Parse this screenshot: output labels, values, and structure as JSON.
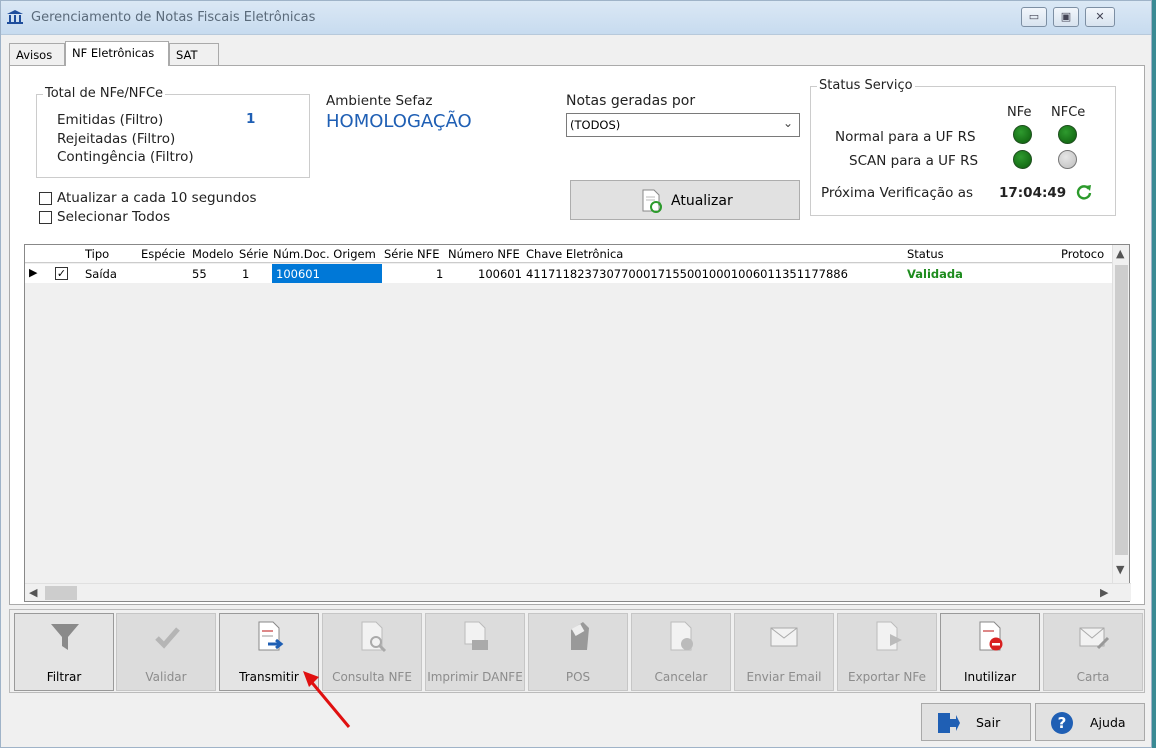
{
  "window": {
    "title": "Gerenciamento de Notas Fiscais Eletrônicas",
    "controls": [
      "minimize",
      "restore",
      "close"
    ]
  },
  "tabs": [
    {
      "label": "Avisos",
      "active": false
    },
    {
      "label": "NF Eletrônicas",
      "active": true
    },
    {
      "label": "SAT",
      "active": false
    }
  ],
  "totals": {
    "legend": "Total de NFe/NFCe",
    "emitidas_label": "Emitidas (Filtro)",
    "emitidas_value": "1",
    "rejeitadas_label": "Rejeitadas (Filtro)",
    "contingencia_label": "Contingência (Filtro)"
  },
  "ambiente": {
    "label": "Ambiente Sefaz",
    "value": "HOMOLOGAÇÃO"
  },
  "notas_geradas": {
    "label": "Notas geradas por",
    "selected": "(TODOS)"
  },
  "options": {
    "auto_refresh_label": "Atualizar a cada 10 segundos",
    "auto_refresh_checked": false,
    "select_all_label": "Selecionar Todos",
    "select_all_checked": false
  },
  "refresh_button": {
    "label": "Atualizar"
  },
  "status_servico": {
    "legend": "Status Serviço",
    "col_nfe": "NFe",
    "col_nfce": "NFCe",
    "rows": [
      {
        "label": "Normal para a UF RS",
        "nfe": "on",
        "nfce": "on"
      },
      {
        "label": "SCAN para a UF RS",
        "nfe": "on",
        "nfce": "off"
      }
    ],
    "next_check_label": "Próxima Verificação as",
    "next_check_time": "17:04:49"
  },
  "grid": {
    "columns": [
      "Tipo",
      "Espécie",
      "Modelo",
      "Série",
      "Núm.Doc. Origem",
      "Série NFE",
      "Número NFE",
      "Chave Eletrônica",
      "Status",
      "Protoco"
    ],
    "rows": [
      {
        "checked": true,
        "tipo": "Saída",
        "especie": "",
        "modelo": "55",
        "serie": "1",
        "num_doc_origem": "100601",
        "serie_nfe": "1",
        "numero_nfe": "100601",
        "chave": "41171182373077000171550010001006011351177886",
        "status": "Validada",
        "protocolo": ""
      }
    ]
  },
  "toolbar": [
    {
      "label": "Filtrar",
      "icon": "funnel-icon",
      "enabled": true
    },
    {
      "label": "Validar",
      "icon": "checkmark-icon",
      "enabled": false
    },
    {
      "label": "Transmitir",
      "icon": "document-arrow-icon",
      "enabled": true
    },
    {
      "label": "Consulta NFE",
      "icon": "document-magnifier-icon",
      "enabled": false
    },
    {
      "label": "Imprimir DANFE",
      "icon": "document-printer-icon",
      "enabled": false
    },
    {
      "label": "POS",
      "icon": "pos-printer-icon",
      "enabled": false
    },
    {
      "label": "Cancelar",
      "icon": "document-cancel-icon",
      "enabled": false
    },
    {
      "label": "Enviar Email",
      "icon": "envelope-arrow-icon",
      "enabled": false
    },
    {
      "label": "Exportar NFe",
      "icon": "document-export-icon",
      "enabled": false
    },
    {
      "label": "Inutilizar",
      "icon": "document-forbidden-icon",
      "enabled": true
    },
    {
      "label": "Carta",
      "icon": "envelope-pen-icon",
      "enabled": false
    }
  ],
  "footer": {
    "exit_label": "Sair",
    "help_label": "Ajuda"
  },
  "colors": {
    "ambiente": "#1f5fb4",
    "emitidas_value": "#1f5fb4",
    "status_ok": "#1e8c1e",
    "selection": "#0078d7",
    "annotation_arrow": "#e01010"
  }
}
